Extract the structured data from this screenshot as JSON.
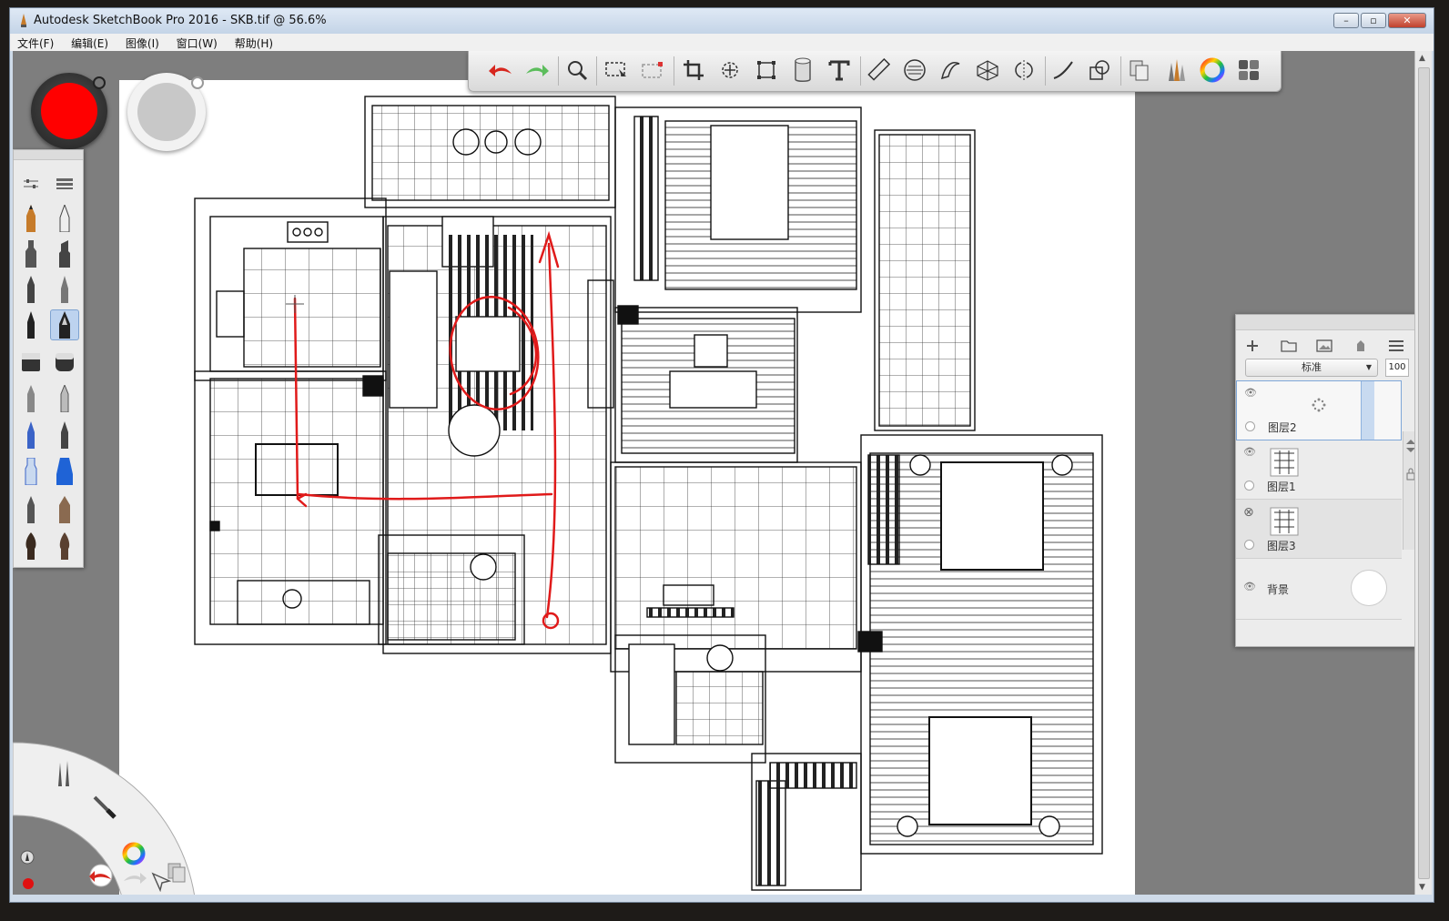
{
  "window": {
    "title": "Autodesk SketchBook Pro 2016 - SKB.tif @ 56.6%",
    "controls": {
      "minimize": "–",
      "maximize": "▫",
      "close": "✕"
    }
  },
  "menu": {
    "items": [
      "文件(F)",
      "编辑(E)",
      "图像(I)",
      "窗口(W)",
      "帮助(H)"
    ]
  },
  "toolbar": {
    "tools": [
      {
        "name": "undo-icon",
        "color": "#d7261e"
      },
      {
        "name": "redo-icon",
        "color": "#3fa63f"
      },
      {
        "name": "zoom-icon"
      },
      {
        "name": "rect-select-icon"
      },
      {
        "name": "lasso-select-icon"
      },
      {
        "name": "crop-icon"
      },
      {
        "name": "transform-icon"
      },
      {
        "name": "distort-icon"
      },
      {
        "name": "fill-bucket-icon"
      },
      {
        "name": "text-icon"
      },
      {
        "name": "ruler-icon"
      },
      {
        "name": "ellipse-guide-icon"
      },
      {
        "name": "french-curve-icon"
      },
      {
        "name": "perspective-icon"
      },
      {
        "name": "symmetry-icon"
      },
      {
        "name": "stroke-icon"
      },
      {
        "name": "shapes-icon"
      },
      {
        "name": "copy-paste-icon"
      },
      {
        "name": "brush-library-icon"
      },
      {
        "name": "color-wheel-icon"
      },
      {
        "name": "layout-icon"
      }
    ]
  },
  "color_puck": {
    "primary": "#ff0000",
    "secondary": "#c8c8c8"
  },
  "layers": {
    "blend_mode": "标准",
    "opacity": "100",
    "items": [
      {
        "name": "图层2",
        "visible": true,
        "selected": true
      },
      {
        "name": "图层1",
        "visible": true,
        "selected": false
      },
      {
        "name": "图层3",
        "visible": false,
        "selected": false
      },
      {
        "name": "背景",
        "visible": true,
        "selected": false
      }
    ]
  },
  "colors": {
    "accent_red": "#e02020",
    "drawing_red": "#e01a1a",
    "ink": "#111111"
  }
}
